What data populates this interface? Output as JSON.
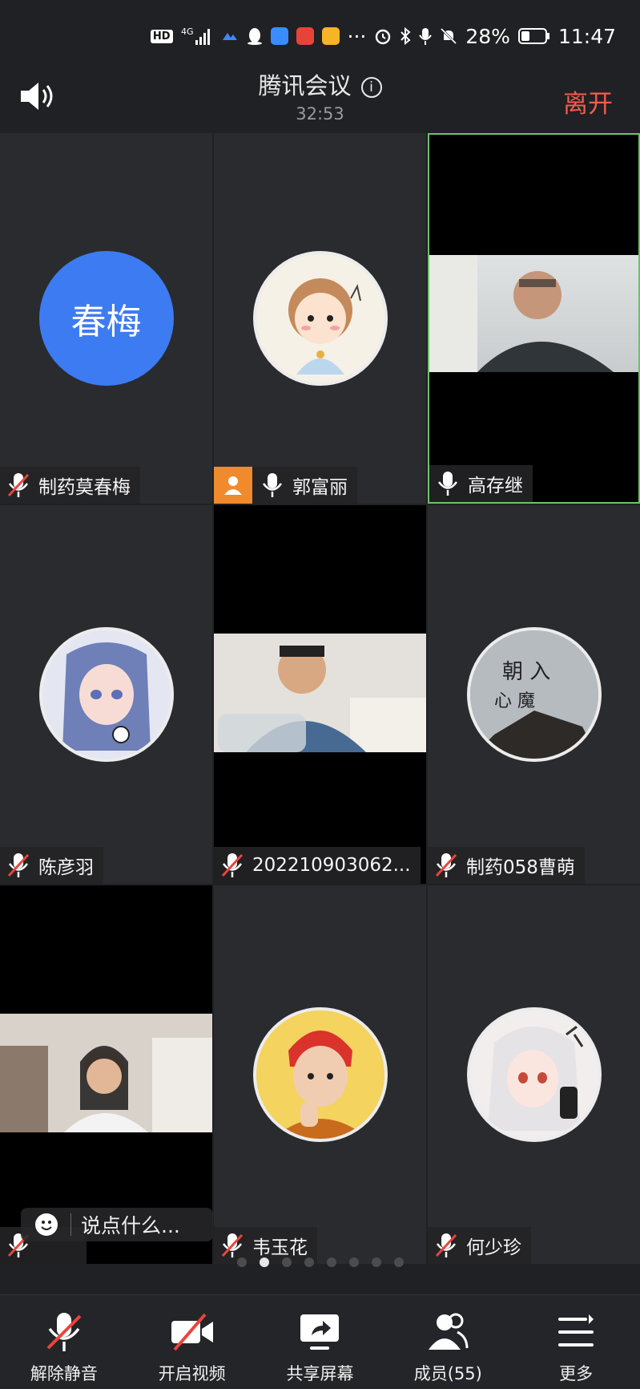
{
  "status_bar": {
    "hd": "HD",
    "network": "4G",
    "battery": "28%",
    "time": "11:47",
    "more": "···"
  },
  "header": {
    "title": "腾讯会议",
    "timer": "32:53",
    "leave_label": "离开"
  },
  "tiles": [
    {
      "name": "制药莫春梅",
      "avatar_text": "春梅",
      "muted": true
    },
    {
      "name": "郭富丽",
      "muted": false,
      "sharing": true
    },
    {
      "name": "高存继",
      "muted": false,
      "video": true,
      "active": true
    },
    {
      "name": "陈彦羽",
      "muted": true
    },
    {
      "name": "202210903062...",
      "muted": true,
      "video": true
    },
    {
      "name": "制药058曹萌",
      "muted": true
    },
    {
      "name": "",
      "muted": true,
      "video": true
    },
    {
      "name": "韦玉花",
      "muted": true
    },
    {
      "name": "何少珍",
      "muted": true
    }
  ],
  "chat": {
    "placeholder": "说点什么..."
  },
  "pages": {
    "count": 8,
    "current": 2
  },
  "toolbar": {
    "unmute": "解除静音",
    "video": "开启视频",
    "share": "共享屏幕",
    "members": "成员(55)",
    "more": "更多"
  },
  "colors": {
    "accent_red": "#f25c4f",
    "avatar_blue": "#3d7bf2",
    "share_orange": "#f08a2c",
    "active_border": "#6cc26a"
  }
}
